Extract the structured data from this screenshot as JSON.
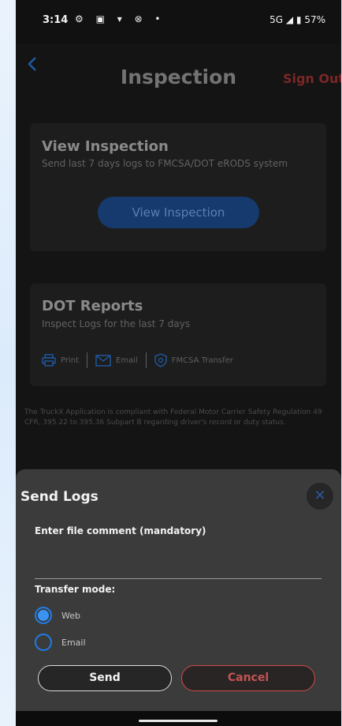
{
  "status_bar": {
    "time": "3:14",
    "icons": "⚙ ▣ ▾ ⊗ •",
    "right": "5G ◢ ▮ 57%"
  },
  "header": {
    "title": "Inspection",
    "sign_out": "Sign Out"
  },
  "view_inspection": {
    "title": "View Inspection",
    "subtitle": "Send last 7 days logs to FMCSA/DOT eRODS system",
    "button": "View Inspection"
  },
  "dot_reports": {
    "title": "DOT Reports",
    "subtitle": "Inspect Logs for the last 7 days",
    "actions": [
      {
        "label": "Print",
        "icon": "printer-icon"
      },
      {
        "label": "Email",
        "icon": "envelope-icon"
      },
      {
        "label": "FMCSA Transfer",
        "icon": "shield-icon"
      }
    ]
  },
  "compliance_text": "The TruckX Application is compliant with Federal Motor Carrier Safety Regulation 49 CFR, 395.22 to 395.36 Subpart B regarding driver's record or duty status.",
  "send_logs": {
    "title": "Send Logs",
    "comment_label": "Enter file comment (mandatory)",
    "comment_value": "",
    "transfer_mode_label": "Transfer mode:",
    "options": [
      {
        "label": "Web",
        "selected": true
      },
      {
        "label": "Email",
        "selected": false
      }
    ],
    "send_button": "Send",
    "cancel_button": "Cancel"
  },
  "colors": {
    "accent_blue": "#1f7ce8",
    "sign_out_red": "#7c2626",
    "cancel_red": "#d04a4a"
  }
}
